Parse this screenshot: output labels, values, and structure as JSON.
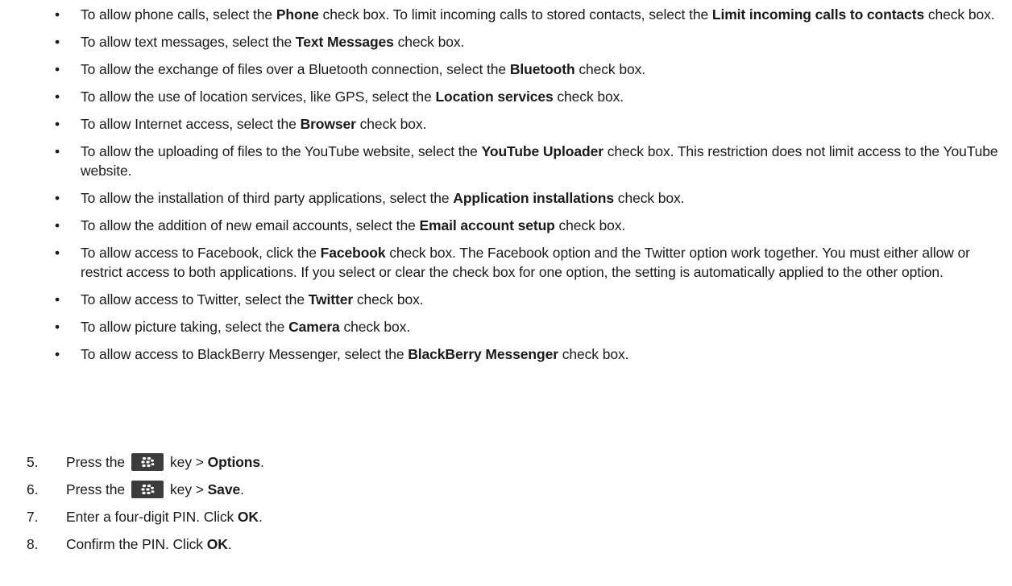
{
  "bullets": [
    {
      "pre": "To allow phone calls, select the ",
      "b1": "Phone",
      "mid": " check box. To limit incoming calls to stored contacts, select the ",
      "b2": "Limit incoming calls to contacts",
      "post": " check box."
    },
    {
      "pre": "To allow text messages, select the ",
      "b1": "Text Messages",
      "post": " check box."
    },
    {
      "pre": "To allow the exchange of files over a Bluetooth connection, select the ",
      "b1": "Bluetooth",
      "post": " check box."
    },
    {
      "pre": "To allow the use of location services, like GPS, select the ",
      "b1": "Location services",
      "post": " check box."
    },
    {
      "pre": "To allow Internet access, select the ",
      "b1": "Browser",
      "post": " check box."
    },
    {
      "pre": "To allow the uploading of files to the YouTube website, select the ",
      "b1": "YouTube Uploader",
      "post": " check box. This restriction does not limit access to the YouTube website."
    },
    {
      "pre": "To allow the installation of third party applications, select the ",
      "b1": "Application installations",
      "post": " check box."
    },
    {
      "pre": "To allow the addition of new email accounts, select the ",
      "b1": "Email account setup",
      "post": " check box."
    },
    {
      "pre": "To allow access to Facebook, click the ",
      "b1": "Facebook",
      "post": " check box. The Facebook option and the Twitter option work together. You must either allow or restrict access to both applications. If you select or clear the check box for one option, the setting is automatically applied to the other option."
    },
    {
      "pre": "To allow access to Twitter, select the ",
      "b1": "Twitter",
      "post": " check box."
    },
    {
      "pre": "To allow picture taking, select the ",
      "b1": "Camera",
      "post": " check box."
    },
    {
      "pre": "To allow access to BlackBerry Messenger, select the ",
      "b1": "BlackBerry Messenger",
      "post": " check box."
    }
  ],
  "steps": [
    {
      "num": "5.",
      "pre": "Press the",
      "key_icon": "blackberry-menu-key-icon",
      "mid": "key > ",
      "b1": "Options",
      "post": "."
    },
    {
      "num": "6.",
      "pre": "Press the",
      "key_icon": "blackberry-menu-key-icon",
      "mid": "key > ",
      "b1": "Save",
      "post": "."
    },
    {
      "num": "7.",
      "pre": "Enter a four-digit PIN. Click ",
      "b1": "OK",
      "post": "."
    },
    {
      "num": "8.",
      "pre": "Confirm the PIN. Click ",
      "b1": "OK",
      "post": "."
    }
  ],
  "bullet_glyph": "•"
}
